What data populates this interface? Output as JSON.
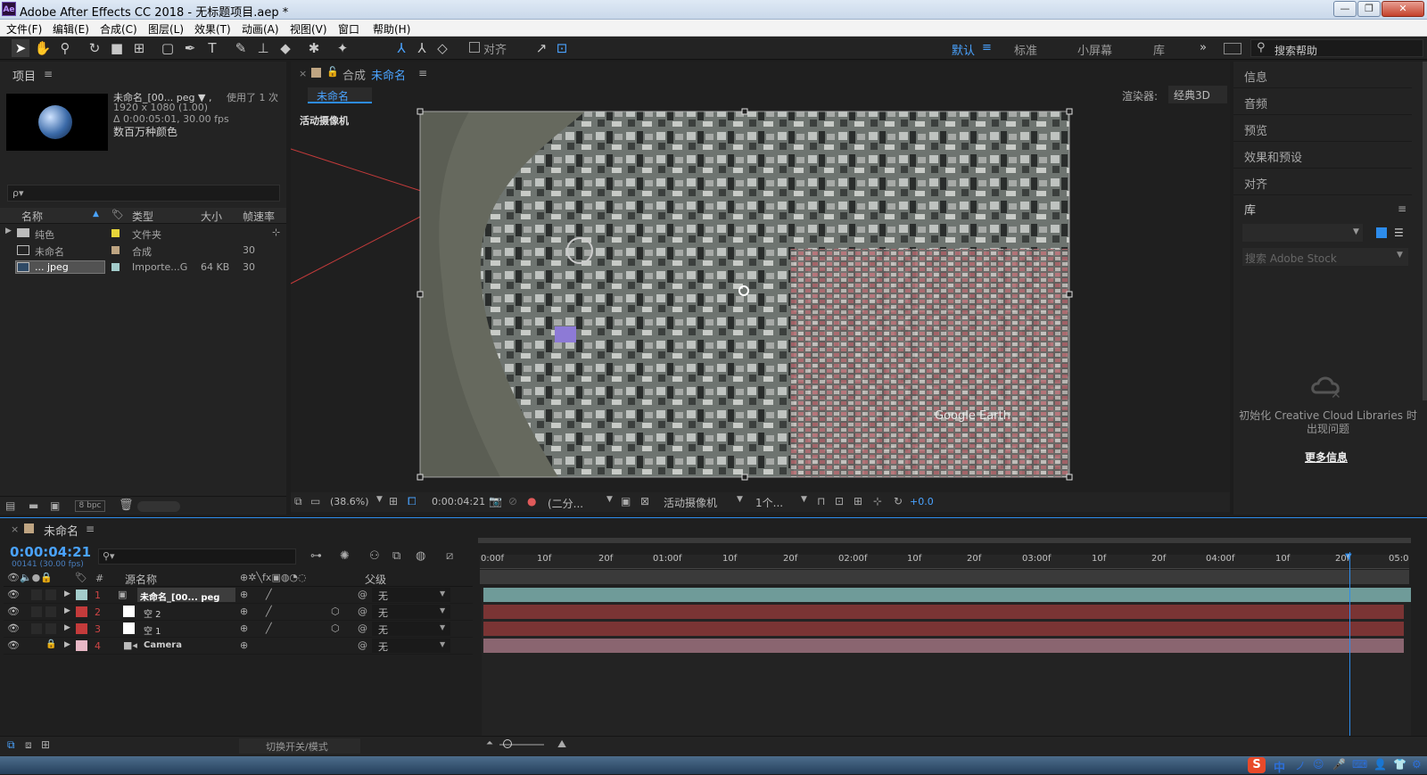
{
  "window": {
    "app_title": "Adobe After Effects CC 2018 - 无标题项目.aep *",
    "app_icon": "Ae",
    "controls": [
      "minimize-icon",
      "restore-icon",
      "close-icon"
    ]
  },
  "menu": [
    "文件(F)",
    "编辑(E)",
    "合成(C)",
    "图层(L)",
    "效果(T)",
    "动画(A)",
    "视图(V)",
    "窗口",
    "帮助(H)"
  ],
  "toolbar": {
    "align_label": "对齐",
    "workspaces": [
      "默认",
      "标准",
      "小屏幕",
      "库"
    ],
    "more": "»",
    "search_placeholder": "搜索帮助"
  },
  "project": {
    "title": "项目",
    "item_name": "未命名_[00... peg ▼ ,",
    "used": "使用了 1 次",
    "dims": "1920 x 1080 (1.00)",
    "duration": "Δ 0:00:05:01, 30.00 fps",
    "colors": "数百万种颜色",
    "search_placeholder": "ρ▾",
    "columns": [
      "名称",
      "类型",
      "大小",
      "帧速率"
    ],
    "rows": [
      {
        "name": "纯色",
        "type": "文件夹",
        "size": "",
        "fps": "",
        "color": "#e7d53a"
      },
      {
        "name": "未命名",
        "type": "合成",
        "size": "",
        "fps": "30",
        "color": "#bfa582"
      },
      {
        "name": "... jpeg",
        "type": "Importe...G",
        "size": "64 KB",
        "fps": "30",
        "color": "#a3cccb"
      }
    ],
    "bpc": "8 bpc"
  },
  "composition": {
    "tab_prefix": "合成",
    "tab_name": "未命名",
    "subtab": "未命名",
    "renderer_label": "渲染器:",
    "renderer_value": "经典3D",
    "camera_label": "活动摄像机",
    "watermark": "Google Earth",
    "footer": {
      "zoom": "(38.6%)",
      "time": "0:00:04:21",
      "resolution": "(二分...",
      "view": "活动摄像机",
      "views": "1个...",
      "exposure": "+0.0"
    }
  },
  "right_panel": {
    "items": [
      "信息",
      "音频",
      "预览",
      "效果和预设",
      "对齐"
    ],
    "library_title": "库",
    "stock_placeholder": "搜索 Adobe Stock",
    "cc_message": "初始化 Creative Cloud Libraries 时出现问题",
    "more_info": "更多信息"
  },
  "timeline": {
    "tab": "未命名",
    "timecode": "0:00:04:21",
    "frame_info": "00141 (30.00 fps)",
    "col_source": "源名称",
    "col_parent": "父级",
    "layers": [
      {
        "num": "1",
        "name": "未命名_[00... peg",
        "parent": "无",
        "label": "#a3cccb",
        "bar": "#6f9b99"
      },
      {
        "num": "2",
        "name": "空 2",
        "parent": "无",
        "label": "#c43b3b",
        "bar": "#7a3434"
      },
      {
        "num": "3",
        "name": "空 1",
        "parent": "无",
        "label": "#c43b3b",
        "bar": "#7a3434"
      },
      {
        "num": "4",
        "name": "Camera",
        "parent": "无",
        "label": "#e8b8c6",
        "bar": "#8a6570"
      }
    ],
    "ruler": [
      "0:00f",
      "10f",
      "20f",
      "01:00f",
      "10f",
      "20f",
      "02:00f",
      "10f",
      "20f",
      "03:00f",
      "10f",
      "20f",
      "04:00f",
      "10f",
      "20f",
      "05:0"
    ],
    "toggle_label": "切换开关/模式"
  },
  "taskbar": {
    "ime": [
      "中",
      "ノ",
      "☺"
    ]
  },
  "colors": {
    "accent_blue": "#2d8ceb",
    "panel_bg": "#232323",
    "panel_dark": "#1d1d1d",
    "title_grad": "#c9d8ea"
  }
}
